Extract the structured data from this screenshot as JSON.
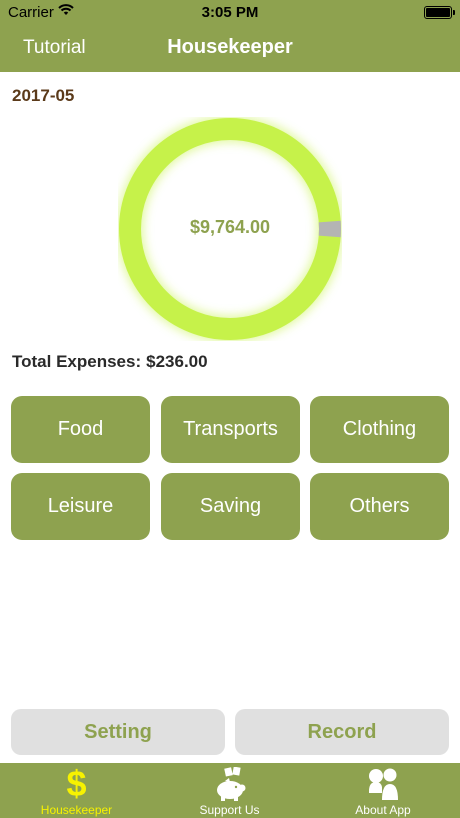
{
  "status_bar": {
    "carrier": "Carrier",
    "time": "3:05 PM"
  },
  "nav": {
    "tutorial_label": "Tutorial",
    "title": "Housekeeper"
  },
  "month": "2017-05",
  "balance": {
    "amount": "$9,764.00",
    "ring_color": "#c6f24a",
    "spent_color": "#b4b4b4",
    "spent_fraction": 0.0236
  },
  "total_expenses": {
    "label": "Total Expenses:",
    "value": "$236.00"
  },
  "categories": [
    "Food",
    "Transports",
    "Clothing",
    "Leisure",
    "Saving",
    "Others"
  ],
  "actions": {
    "setting_label": "Setting",
    "record_label": "Record"
  },
  "tabs": [
    {
      "label": "Housekeeper",
      "icon": "dollar-icon",
      "active": true
    },
    {
      "label": "Support Us",
      "icon": "piggy-bank-icon",
      "active": false
    },
    {
      "label": "About App",
      "icon": "people-icon",
      "active": false
    }
  ],
  "colors": {
    "accent": "#8ea24f",
    "active_tab": "#f7f200",
    "month_text": "#5b3a1a"
  }
}
